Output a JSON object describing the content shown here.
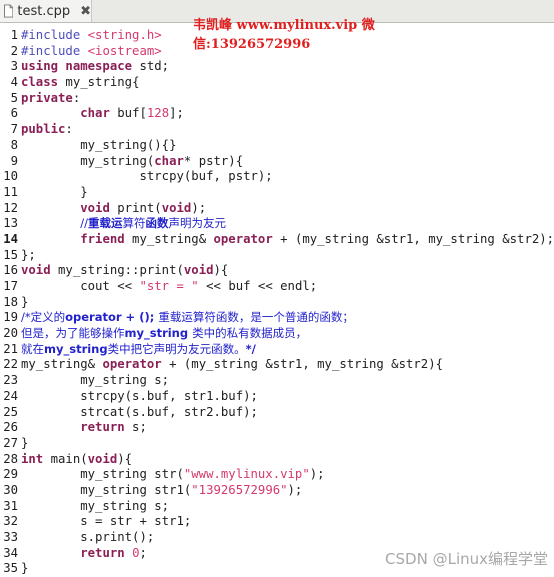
{
  "tab": {
    "title": "test.cpp",
    "close": "✖"
  },
  "watermark_top": {
    "line1": "韦凯峰 www.mylinux.vip 微",
    "line2": "信:13926572996"
  },
  "watermark_bottom": "CSDN @Linux编程学堂",
  "lines": [
    {
      "n": "1",
      "t": [
        [
          "p",
          "#include "
        ],
        [
          "s",
          "<string.h>"
        ]
      ]
    },
    {
      "n": "2",
      "t": [
        [
          "p",
          "#include "
        ],
        [
          "s",
          "<iostream>"
        ]
      ]
    },
    {
      "n": "3",
      "t": [
        [
          "k",
          "using namespace"
        ],
        [
          "x",
          " std;"
        ]
      ]
    },
    {
      "n": "4",
      "t": [
        [
          "k",
          "class"
        ],
        [
          "x",
          " my_string{"
        ]
      ]
    },
    {
      "n": "5",
      "t": [
        [
          "k",
          "private"
        ],
        [
          "x",
          ":"
        ]
      ]
    },
    {
      "n": "6",
      "t": [
        [
          "x",
          "        "
        ],
        [
          "k",
          "char"
        ],
        [
          "x",
          " buf["
        ],
        [
          "n",
          "128"
        ],
        [
          "x",
          "];"
        ]
      ]
    },
    {
      "n": "7",
      "t": [
        [
          "k",
          "public"
        ],
        [
          "x",
          ":"
        ]
      ]
    },
    {
      "n": "8",
      "t": [
        [
          "x",
          "        my_string(){}"
        ]
      ]
    },
    {
      "n": "9",
      "t": [
        [
          "x",
          "        my_string("
        ],
        [
          "k",
          "char"
        ],
        [
          "x",
          "* pstr){"
        ]
      ]
    },
    {
      "n": "10",
      "t": [
        [
          "x",
          "                strcpy(buf, pstr);"
        ]
      ]
    },
    {
      "n": "11",
      "t": [
        [
          "x",
          "        }"
        ]
      ]
    },
    {
      "n": "12",
      "t": [
        [
          "x",
          "        "
        ],
        [
          "k",
          "void"
        ],
        [
          "x",
          " print("
        ],
        [
          "k",
          "void"
        ],
        [
          "x",
          ");"
        ]
      ]
    },
    {
      "n": "13",
      "t": [
        [
          "x",
          "        "
        ],
        [
          "c",
          "//"
        ],
        [
          "cb",
          "重载运"
        ],
        [
          "c",
          "算符"
        ],
        [
          "cb",
          "函数"
        ],
        [
          "c",
          "声明为友元"
        ]
      ]
    },
    {
      "n": "14",
      "cur": true,
      "t": [
        [
          "x",
          "        "
        ],
        [
          "k",
          "friend"
        ],
        [
          "x",
          " my_string& "
        ],
        [
          "k",
          "operator"
        ],
        [
          "x",
          " + (my_string &str1, my_string &str2);"
        ]
      ]
    },
    {
      "n": "15",
      "t": [
        [
          "x",
          "};"
        ]
      ]
    },
    {
      "n": "16",
      "t": [
        [
          "k",
          "void"
        ],
        [
          "x",
          " my_string::print("
        ],
        [
          "k",
          "void"
        ],
        [
          "x",
          "){"
        ]
      ]
    },
    {
      "n": "17",
      "t": [
        [
          "x",
          "        cout << "
        ],
        [
          "s",
          "\"str = \""
        ],
        [
          "x",
          " << buf << endl;"
        ]
      ]
    },
    {
      "n": "18",
      "t": [
        [
          "x",
          "}"
        ]
      ]
    },
    {
      "n": "19",
      "t": [
        [
          "c",
          "/*定义的"
        ],
        [
          "cb",
          "operator + (); "
        ],
        [
          "c",
          "重载运算符函数，是一个普通的函数；"
        ]
      ]
    },
    {
      "n": "20",
      "t": [
        [
          "c",
          "但是，为了能够操作"
        ],
        [
          "cb",
          "my_string "
        ],
        [
          "c",
          "类中的私有数据成员，"
        ]
      ]
    },
    {
      "n": "21",
      "t": [
        [
          "c",
          "就在"
        ],
        [
          "cb",
          "my_string"
        ],
        [
          "c",
          "类中把它声明为友元函数。"
        ],
        [
          "cb",
          "*/"
        ]
      ]
    },
    {
      "n": "22",
      "t": [
        [
          "x",
          "my_string& "
        ],
        [
          "k",
          "operator"
        ],
        [
          "x",
          " + (my_string &str1, my_string &str2){"
        ]
      ]
    },
    {
      "n": "23",
      "t": [
        [
          "x",
          "        my_string s;"
        ]
      ]
    },
    {
      "n": "24",
      "t": [
        [
          "x",
          "        strcpy(s.buf, str1.buf);"
        ]
      ]
    },
    {
      "n": "25",
      "t": [
        [
          "x",
          "        strcat(s.buf, str2.buf);"
        ]
      ]
    },
    {
      "n": "26",
      "t": [
        [
          "x",
          "        "
        ],
        [
          "k",
          "return"
        ],
        [
          "x",
          " s;"
        ]
      ]
    },
    {
      "n": "27",
      "t": [
        [
          "x",
          "}"
        ]
      ]
    },
    {
      "n": "28",
      "t": [
        [
          "k",
          "int"
        ],
        [
          "x",
          " main("
        ],
        [
          "k",
          "void"
        ],
        [
          "x",
          "){"
        ]
      ]
    },
    {
      "n": "29",
      "t": [
        [
          "x",
          "        my_string str("
        ],
        [
          "s",
          "\"www.mylinux.vip\""
        ],
        [
          "x",
          ");"
        ]
      ]
    },
    {
      "n": "30",
      "t": [
        [
          "x",
          "        my_string str1("
        ],
        [
          "s",
          "\"13926572996\""
        ],
        [
          "x",
          ");"
        ]
      ]
    },
    {
      "n": "31",
      "t": [
        [
          "x",
          "        my_string s;"
        ]
      ]
    },
    {
      "n": "32",
      "t": [
        [
          "x",
          "        s = str + str1;"
        ]
      ]
    },
    {
      "n": "33",
      "t": [
        [
          "x",
          "        s.print();"
        ]
      ]
    },
    {
      "n": "34",
      "t": [
        [
          "x",
          "        "
        ],
        [
          "k",
          "return"
        ],
        [
          "x",
          " "
        ],
        [
          "n",
          "0"
        ],
        [
          "x",
          ";"
        ]
      ]
    },
    {
      "n": "35",
      "t": [
        [
          "x",
          "}"
        ]
      ]
    }
  ]
}
